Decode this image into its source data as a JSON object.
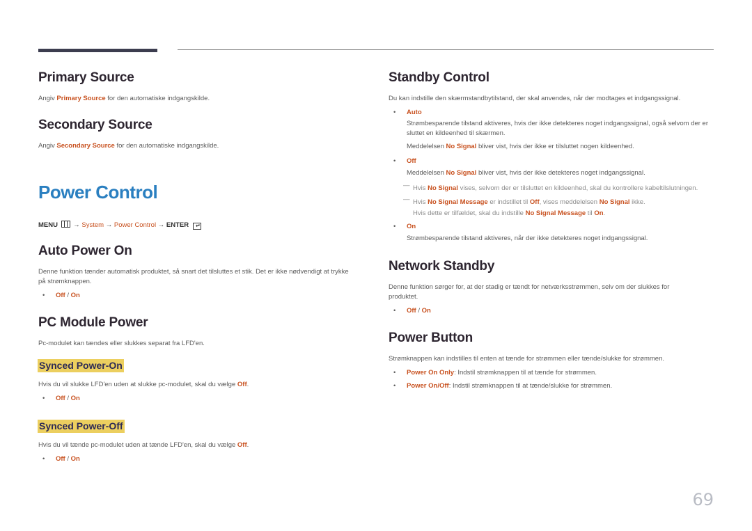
{
  "page_number": "69",
  "left": {
    "primary_source": {
      "title": "Primary Source",
      "text_pre": "Angiv ",
      "text_hl": "Primary Source",
      "text_post": " for den automatiske indgangskilde."
    },
    "secondary_source": {
      "title": "Secondary Source",
      "text_pre": "Angiv ",
      "text_hl": "Secondary Source",
      "text_post": " for den automatiske indgangskilde."
    },
    "power_control": {
      "title": "Power Control",
      "menu_path": {
        "menu": "MENU",
        "arrow1": "→",
        "system": "System",
        "arrow2": "→",
        "power_control": "Power Control",
        "arrow3": "→",
        "enter": "ENTER",
        "enter_glyph": "↵"
      }
    },
    "auto_power_on": {
      "title": "Auto Power On",
      "text": "Denne funktion tænder automatisk produktet, så snart det tilsluttes et stik. Det er ikke nødvendigt at trykke på strømknappen.",
      "option_off": "Off",
      "sep": " / ",
      "option_on": "On"
    },
    "pc_module_power": {
      "title": "PC Module Power",
      "text": "Pc-modulet kan tændes eller slukkes separat fra LFD'en."
    },
    "synced_power_on": {
      "title": "Synced Power-On",
      "text_pre": "Hvis du vil slukke LFD'en uden at slukke pc-modulet, skal du vælge ",
      "text_hl": "Off",
      "text_post": ".",
      "option_off": "Off",
      "sep": " / ",
      "option_on": "On"
    },
    "synced_power_off": {
      "title": "Synced Power-Off",
      "text_pre": "Hvis du vil tænde pc-modulet uden at tænde LFD'en, skal du vælge ",
      "text_hl": "Off",
      "text_post": ".",
      "option_off": "Off",
      "sep": " / ",
      "option_on": "On"
    }
  },
  "right": {
    "standby_control": {
      "title": "Standby Control",
      "text": "Du kan indstille den skærmstandbytilstand, der skal anvendes, når der modtages et indgangssignal.",
      "auto": {
        "label": "Auto",
        "desc": "Strømbesparende tilstand aktiveres, hvis der ikke detekteres noget indgangssignal, også selvom der er sluttet en kildeenhed til skærmen.",
        "msg_pre": "Meddelelsen ",
        "msg_hl": "No Signal",
        "msg_post": " bliver vist, hvis der ikke er tilsluttet nogen kildeenhed."
      },
      "off": {
        "label": "Off",
        "msg_pre": "Meddelelsen ",
        "msg_hl": "No Signal",
        "msg_post": " bliver vist, hvis der ikke detekteres noget indgangssignal.",
        "note1_pre": "Hvis ",
        "note1_hl": "No Signal",
        "note1_post": " vises, selvom der er tilsluttet en kildeenhed, skal du kontrollere kabeltilslutningen.",
        "note2_pre": "Hvis ",
        "note2_hl1": "No Signal Message",
        "note2_mid1": " er indstillet til ",
        "note2_hl2": "Off",
        "note2_mid2": ", vises meddelelsen ",
        "note2_hl3": "No Signal",
        "note2_post": " ikke.",
        "note3_pre": "Hvis dette er tilfældet, skal du indstille ",
        "note3_hl1": "No Signal Message",
        "note3_mid": " til ",
        "note3_hl2": "On",
        "note3_post": "."
      },
      "on": {
        "label": "On",
        "desc": "Strømbesparende tilstand aktiveres, når der ikke detekteres noget indgangssignal."
      }
    },
    "network_standby": {
      "title": "Network Standby",
      "text": "Denne funktion sørger for, at der stadig er tændt for netværksstrømmen, selv om der slukkes for produktet.",
      "option_off": "Off",
      "sep": " / ",
      "option_on": "On"
    },
    "power_button": {
      "title": "Power Button",
      "text": "Strømknappen kan indstilles til enten at tænde for strømmen eller tænde/slukke for strømmen.",
      "opt1_label": "Power On Only",
      "opt1_text": ": Indstil strømknappen til at tænde for strømmen.",
      "opt2_label": "Power On/Off",
      "opt2_text": ": Indstil strømknappen til at tænde/slukke for strømmen."
    }
  },
  "bullet_glyph": "•",
  "note_glyph": "—"
}
